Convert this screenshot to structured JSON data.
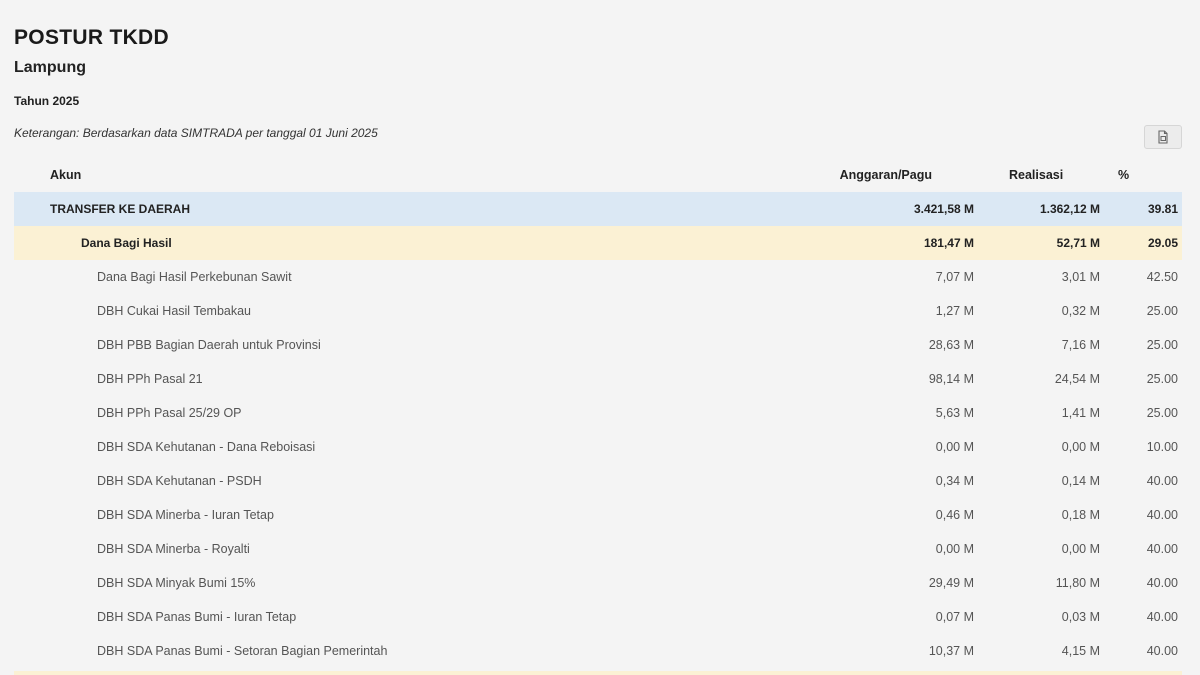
{
  "header": {
    "title": "POSTUR TKDD",
    "region": "Lampung",
    "year": "Tahun 2025",
    "note": "Keterangan: Berdasarkan data SIMTRADA per tanggal 01 Juni 2025"
  },
  "toolbar": {
    "export_icon": "export-document-icon"
  },
  "table": {
    "columns": {
      "akun": "Akun",
      "anggaran": "Anggaran/Pagu",
      "realisasi": "Realisasi",
      "pct": "%"
    },
    "rows": [
      {
        "akun": "TRANSFER KE DAERAH",
        "anggaran": "3.421,58 M",
        "realisasi": "1.362,12 M",
        "pct": "39.81"
      },
      {
        "akun": "Dana Bagi Hasil",
        "anggaran": "181,47 M",
        "realisasi": "52,71 M",
        "pct": "29.05"
      },
      {
        "akun": "Dana Bagi Hasil Perkebunan Sawit",
        "anggaran": "7,07 M",
        "realisasi": "3,01 M",
        "pct": "42.50"
      },
      {
        "akun": "DBH Cukai Hasil Tembakau",
        "anggaran": "1,27 M",
        "realisasi": "0,32 M",
        "pct": "25.00"
      },
      {
        "akun": "DBH PBB Bagian Daerah untuk Provinsi",
        "anggaran": "28,63 M",
        "realisasi": "7,16 M",
        "pct": "25.00"
      },
      {
        "akun": "DBH PPh Pasal 21",
        "anggaran": "98,14 M",
        "realisasi": "24,54 M",
        "pct": "25.00"
      },
      {
        "akun": "DBH PPh Pasal 25/29 OP",
        "anggaran": "5,63 M",
        "realisasi": "1,41 M",
        "pct": "25.00"
      },
      {
        "akun": "DBH SDA Kehutanan - Dana Reboisasi",
        "anggaran": "0,00 M",
        "realisasi": "0,00 M",
        "pct": "10.00"
      },
      {
        "akun": "DBH SDA Kehutanan - PSDH",
        "anggaran": "0,34 M",
        "realisasi": "0,14 M",
        "pct": "40.00"
      },
      {
        "akun": "DBH SDA Minerba - Iuran Tetap",
        "anggaran": "0,46 M",
        "realisasi": "0,18 M",
        "pct": "40.00"
      },
      {
        "akun": "DBH SDA Minerba - Royalti",
        "anggaran": "0,00 M",
        "realisasi": "0,00 M",
        "pct": "40.00"
      },
      {
        "akun": "DBH SDA Minyak Bumi 15%",
        "anggaran": "29,49 M",
        "realisasi": "11,80 M",
        "pct": "40.00"
      },
      {
        "akun": "DBH SDA Panas Bumi - Iuran Tetap",
        "anggaran": "0,07 M",
        "realisasi": "0,03 M",
        "pct": "40.00"
      },
      {
        "akun": "DBH SDA Panas Bumi - Setoran Bagian Pemerintah",
        "anggaran": "10,37 M",
        "realisasi": "4,15 M",
        "pct": "40.00"
      }
    ]
  },
  "colors": {
    "level0_bg": "#dbe8f4",
    "level1_bg": "#fbf1d4",
    "page_bg": "#f4f4f4"
  }
}
